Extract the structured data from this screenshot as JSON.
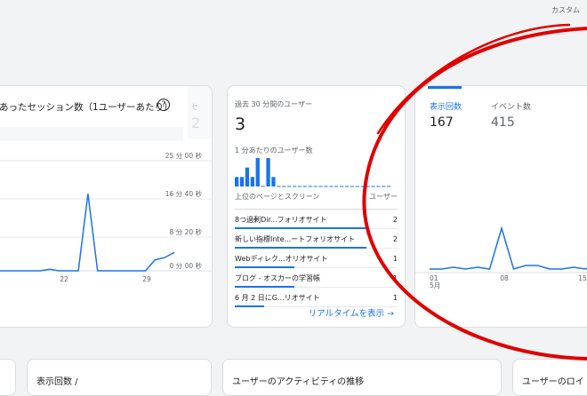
{
  "top_right_label": "カスタム",
  "left_card": {
    "title": "あったセッション数（1ユーザーあたり）",
    "help_icon": "?",
    "hidden_metric_label": "セ",
    "hidden_metric_value": "2",
    "y_ticks": [
      "25 分 00 秒",
      "16 分 40 秒",
      "8 分 20 秒",
      "0 分 00 秒"
    ],
    "x_ticks": [
      "22",
      "29"
    ]
  },
  "mid_card": {
    "title": "過去 30 分間のユーザー",
    "value": "3",
    "per_minute_label": "1 分あたりのユーザー数",
    "table_headers": {
      "page": "上位のページとスクリーン",
      "users": "ユーザー"
    },
    "rows": [
      {
        "page": "8つ過剰Dir...フォリオサイト",
        "users": "2"
      },
      {
        "page": "新しい指標Inte...ートフォリオサイト",
        "users": "2"
      },
      {
        "page": "Webディレク...オリオサイト",
        "users": "1"
      },
      {
        "page": "ブログ - オスカーの学習帳",
        "users": "1"
      },
      {
        "page": "6 月 2 日にG...リオサイト",
        "users": "1"
      }
    ],
    "realtime_link": "リアルタイムを表示",
    "arrow_icon": "→"
  },
  "right_card": {
    "tab1_label": "表示回数",
    "tab1_value": "167",
    "tab2_label": "イベント数",
    "tab2_value": "415",
    "x_ticks": [
      "01\n5月",
      "08",
      "15"
    ]
  },
  "bottom_cards": [
    {
      "label": ""
    },
    {
      "label": "表示回数 /"
    },
    {
      "label": "ユーザーのアクティビティの推移"
    },
    {
      "label": "ユーザーのロイ"
    }
  ],
  "chart_data": [
    {
      "type": "line",
      "title": "",
      "x_ticks": [
        "22",
        "29"
      ],
      "y_ticks": [
        "0 分 00 秒",
        "8 分 20 秒",
        "16 分 40 秒",
        "25 分 00 秒"
      ],
      "ylim": [
        0,
        1500
      ],
      "series": [
        {
          "values": [
            0,
            0,
            0,
            0,
            0,
            0,
            20,
            0,
            0,
            0,
            1050,
            0,
            0,
            0,
            0,
            0,
            0,
            150,
            180,
            250
          ]
        }
      ]
    },
    {
      "type": "bar",
      "title": "1 分あたりのユーザー数",
      "values": [
        1,
        1,
        2,
        1,
        3,
        0,
        3,
        1,
        0,
        0,
        0,
        0,
        0,
        0,
        0,
        0,
        0,
        0,
        0,
        0,
        0,
        0,
        0,
        0,
        0,
        0,
        0,
        0,
        0,
        0
      ]
    },
    {
      "type": "line",
      "title": "表示回数",
      "x_ticks": [
        "01 5月",
        "08",
        "15"
      ],
      "series": [
        {
          "values": [
            2,
            2,
            3,
            2,
            3,
            2,
            25,
            2,
            4,
            4,
            2,
            2,
            3,
            2,
            6
          ]
        }
      ]
    }
  ],
  "colors": {
    "accent": "#1a73e8",
    "annotation": "#e00000"
  }
}
